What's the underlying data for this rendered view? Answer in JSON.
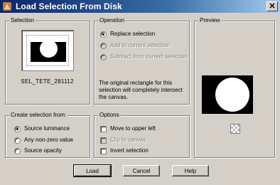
{
  "window": {
    "title": "Load Selection From Disk",
    "close_label": "✕"
  },
  "selection": {
    "legend": "Selection",
    "name": "SEL_TETE_281112"
  },
  "operation": {
    "legend": "Operation",
    "options": [
      {
        "label": "Replace selection",
        "checked": true,
        "enabled": true
      },
      {
        "label": "Add to current selection",
        "checked": false,
        "enabled": false
      },
      {
        "label": "Subtract from current selection",
        "checked": false,
        "enabled": false
      }
    ],
    "info": "The original rectangle for this selection will completely intersect the canvas."
  },
  "preview": {
    "legend": "Preview"
  },
  "create_from": {
    "legend": "Create selection from:",
    "options": [
      {
        "label": "Source luminance",
        "checked": true
      },
      {
        "label": "Any non-zero value",
        "checked": false
      },
      {
        "label": "Source opacity",
        "checked": false
      }
    ]
  },
  "options": {
    "legend": "Options",
    "items": [
      {
        "label": "Move to upper left",
        "checked": false,
        "enabled": true
      },
      {
        "label": "Clip to canvas",
        "checked": false,
        "enabled": false
      },
      {
        "label": "Invert selection",
        "checked": false,
        "enabled": true
      }
    ]
  },
  "buttons": {
    "load": "Load",
    "cancel": "Cancel",
    "help": "Help"
  }
}
